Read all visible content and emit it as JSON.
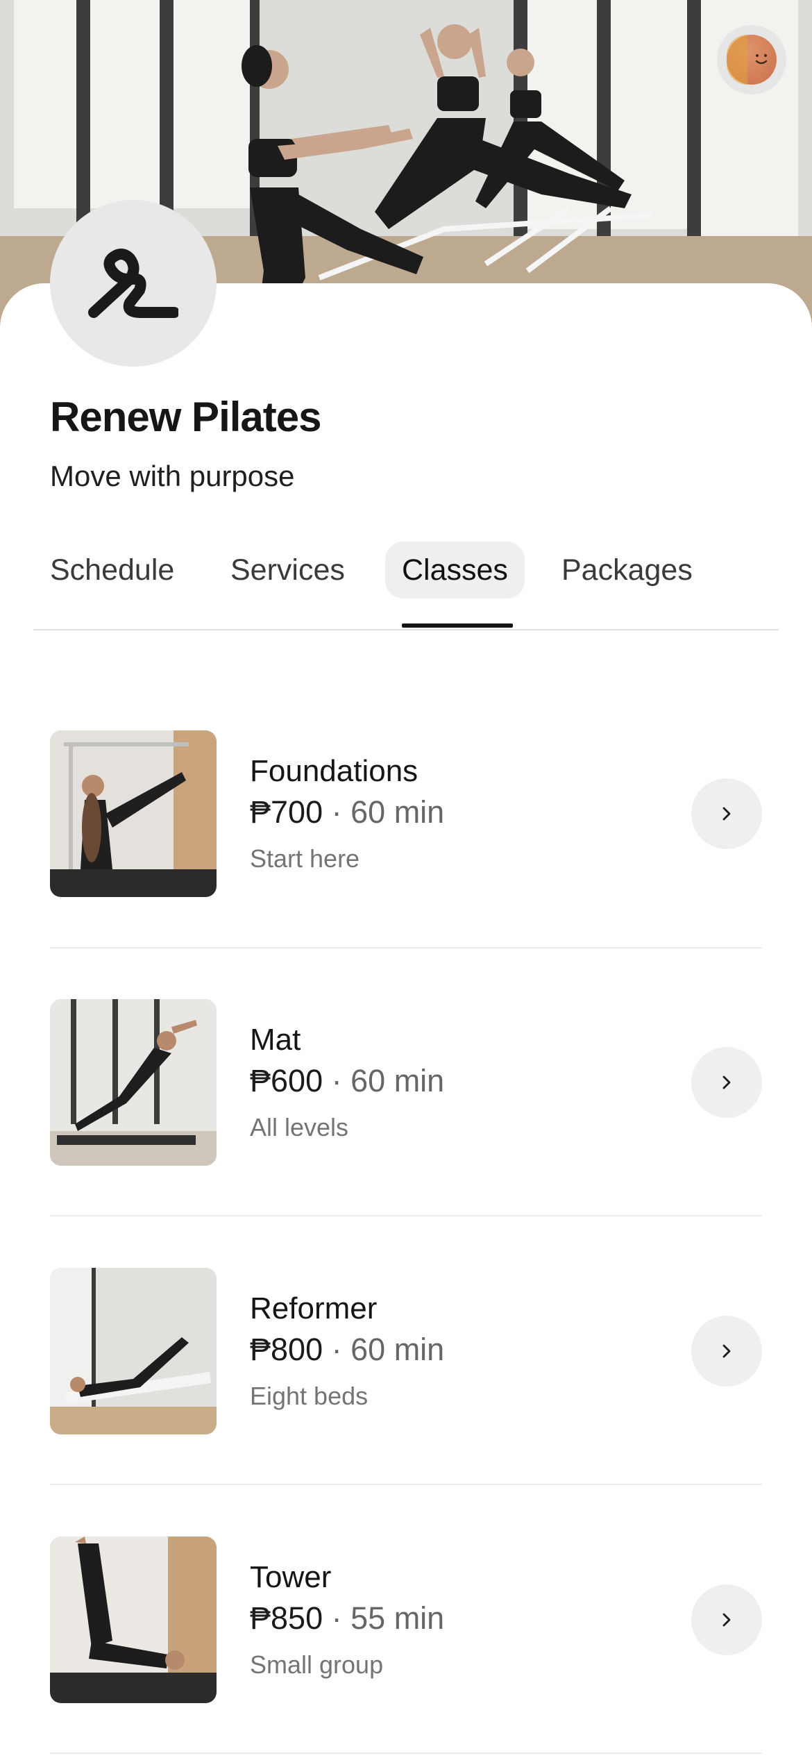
{
  "studio": {
    "name": "Renew Pilates",
    "tagline": "Move with purpose"
  },
  "tabs": [
    {
      "label": "Schedule"
    },
    {
      "label": "Services"
    },
    {
      "label": "Classes",
      "active": true
    },
    {
      "label": "Packages"
    }
  ],
  "classes": [
    {
      "title": "Foundations",
      "price": "₱700",
      "separator": "·",
      "duration": "60 min",
      "subtitle": "Start here"
    },
    {
      "title": "Mat",
      "price": "₱600",
      "separator": "·",
      "duration": "60 min",
      "subtitle": "All levels"
    },
    {
      "title": "Reformer",
      "price": "₱800",
      "separator": "·",
      "duration": "60 min",
      "subtitle": "Eight beds"
    },
    {
      "title": "Tower",
      "price": "₱850",
      "separator": "·",
      "duration": "55 min",
      "subtitle": "Small group"
    }
  ],
  "icons": {
    "brand": "brand-logo-icon",
    "avatar": "user-avatar-icon",
    "chevron": "chevron-right-icon"
  },
  "colors": {
    "tab_active_bg": "#efefef",
    "chevron_button_bg": "#efefef",
    "logo_bg": "#e8e8e8"
  }
}
